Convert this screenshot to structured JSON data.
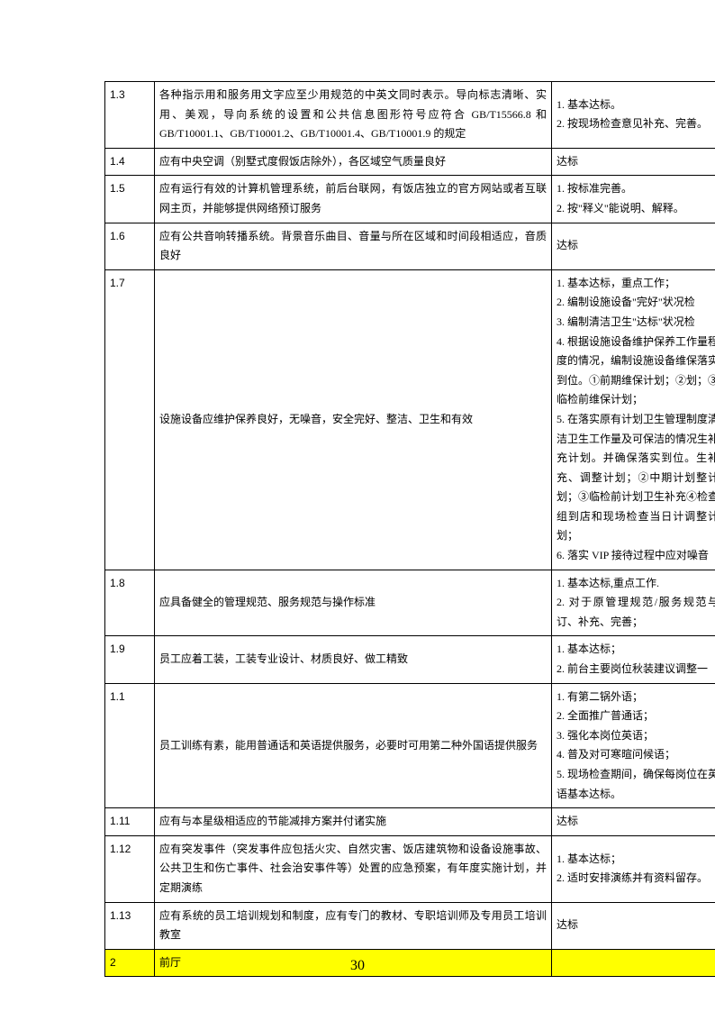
{
  "rows": [
    {
      "num": "1.3",
      "desc": "各种指示用和服务用文字应至少用规范的中英文同时表示。导向标志清晰、实用、美观，导向系统的设置和公共信息图形符号应符合 GB/T15566.8 和GB/T10001.1、GB/T10001.2、GB/T10001.4、GB/T10001.9 的规定",
      "remark": "1. 基本达标。\n2. 按现场检查意见补充、完善。"
    },
    {
      "num": "1.4",
      "desc": "应有中央空调（别墅式度假饭店除外），各区域空气质量良好",
      "remark": "达标",
      "center": true
    },
    {
      "num": "1.5",
      "desc": "应有运行有效的计算机管理系统，前后台联网，有饭店独立的官方网站或者互联网主页，并能够提供网络预订服务",
      "remark": "1. 按标准完善。\n2. 按\"释义\"能说明、解释。"
    },
    {
      "num": "1.6",
      "desc": "应有公共音响转播系统。背景音乐曲目、音量与所在区域和时间段相适应，音质良好",
      "remark": "达标",
      "center": true
    },
    {
      "num": "1.7",
      "desc": "设施设备应维护保养良好，无噪音，安全完好、整洁、卫生和有效",
      "remark": "1. 基本达标，重点工作；\n2. 编制设施设备\"完好\"状况检\n3. 编制清洁卫生\"达标\"状况检\n4. 根据设施设备维护保养工作量程度的情况，编制设施设备维保落实到位。①前期维保计划；②划；③临检前维保计划；\n5. 在落实原有计划卫生管理制度清洁卫生工作量及可保洁的情况生补充计划。并确保落实到位。生补充、调整计划；②中期计划整计划；③临检前计划卫生补充④检查组到店和现场检查当日计调整计划；\n6. 落实 VIP 接待过程中应对噪音"
    },
    {
      "num": "1.8",
      "desc": "应具备健全的管理规范、服务规范与操作标准",
      "remark": "1. 基本达标,重点工作.\n2. 对于原管理规范/服务规范与订、补充、完善；"
    },
    {
      "num": "1.9",
      "desc": "员工应着工装，工装专业设计、材质良好、做工精致",
      "remark": "1. 基本达标；\n2. 前台主要岗位秋装建议调整一"
    },
    {
      "num": "1.1",
      "desc": "员工训练有素，能用普通话和英语提供服务，必要时可用第二种外国语提供服务",
      "remark": "1. 有第二锅外语；\n2. 全面推广普通话；\n3. 强化本岗位英语；\n4. 普及对可寒暄问候语；\n5. 现场检查期间，确保每岗位在英语基本达标。"
    },
    {
      "num": "1.11",
      "desc": "应有与本星级相适应的节能减排方案并付诸实施",
      "remark": "达标",
      "center": true
    },
    {
      "num": "1.12",
      "desc": "应有突发事件（突发事件应包括火灾、自然灾害、饭店建筑物和设备设施事故、公共卫生和伤亡事件、社会治安事件等）处置的应急预案，有年度实施计划，并定期演练",
      "remark": "1. 基本达标；\n2. 适时安排演练并有资料留存。"
    },
    {
      "num": "1.13",
      "desc": "应有系统的员工培训规划和制度，应有专门的教材、专职培训师及专用员工培训教室",
      "remark": "达标",
      "center": true
    },
    {
      "num": "2",
      "desc": "前厅",
      "remark": "",
      "highlight": true
    }
  ],
  "page_number": "30"
}
